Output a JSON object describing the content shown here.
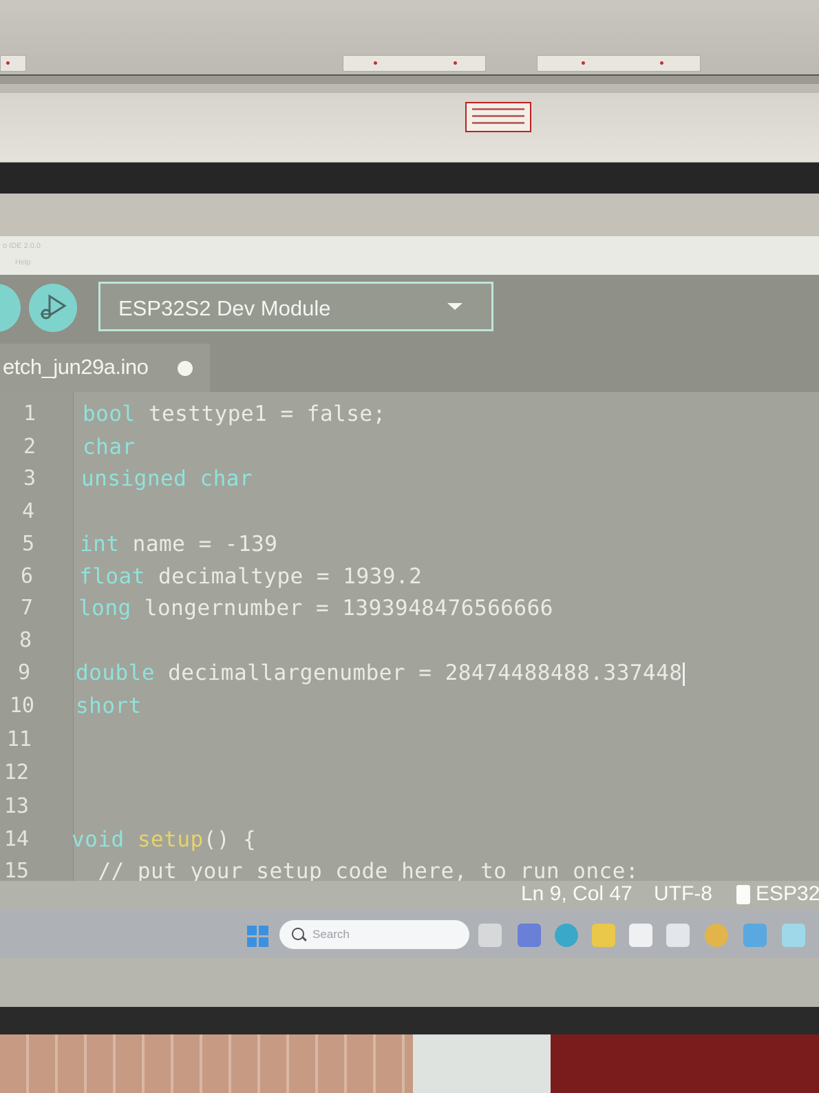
{
  "window": {
    "title": "o IDE 2.0.0",
    "menu_partial": "Help"
  },
  "toolbar": {
    "upload_icon": "upload-icon",
    "debug_icon": "debug-play-icon",
    "board_select": "ESP32S2 Dev Module",
    "board_caret_icon": "chevron-down-icon"
  },
  "tab": {
    "filename": "etch_jun29a.ino",
    "modified_indicator": "●"
  },
  "editor": {
    "line_numbers": [
      "1",
      "2",
      "3",
      "4",
      "5",
      "6",
      "7",
      "8",
      "9",
      "10",
      "11",
      "12",
      "13",
      "14",
      "15"
    ],
    "lines": [
      {
        "type": "bool",
        "rest": " testtype1 = false;"
      },
      {
        "type": "char",
        "rest": ""
      },
      {
        "type": "unsigned char",
        "rest": ""
      },
      {
        "type": "",
        "rest": ""
      },
      {
        "type": "int",
        "rest": " name = -139"
      },
      {
        "type": "float",
        "rest": " decimaltype = 1939.2"
      },
      {
        "type": "long",
        "rest": " longernumber = 1393948476566666"
      },
      {
        "type": "",
        "rest": ""
      },
      {
        "type": "double",
        "rest": " decimallargenumber = 28474488488.337448"
      },
      {
        "type": "short",
        "rest": ""
      },
      {
        "type": "",
        "rest": ""
      },
      {
        "type": "",
        "rest": ""
      },
      {
        "type": "",
        "rest": ""
      },
      {
        "type": "void",
        "fn": "setup",
        "rest": "() {"
      },
      {
        "type": "",
        "rest": "  // put your setup code here, to run once:"
      }
    ],
    "colors": {
      "keyword": "#8ee3dc",
      "function": "#e6d36a",
      "text": "#e9ece6",
      "background": "#a2a39a"
    }
  },
  "statusbar": {
    "position": "Ln 9, Col 47",
    "encoding": "UTF-8",
    "board": "ESP32"
  },
  "taskbar": {
    "search_placeholder": "Search",
    "icons": [
      "windows-start-icon",
      "task-view-icon",
      "chat-icon",
      "edge-icon",
      "file-explorer-icon",
      "store-icon",
      "snipping-icon",
      "chrome-icon",
      "app-icon",
      "app-icon"
    ]
  }
}
